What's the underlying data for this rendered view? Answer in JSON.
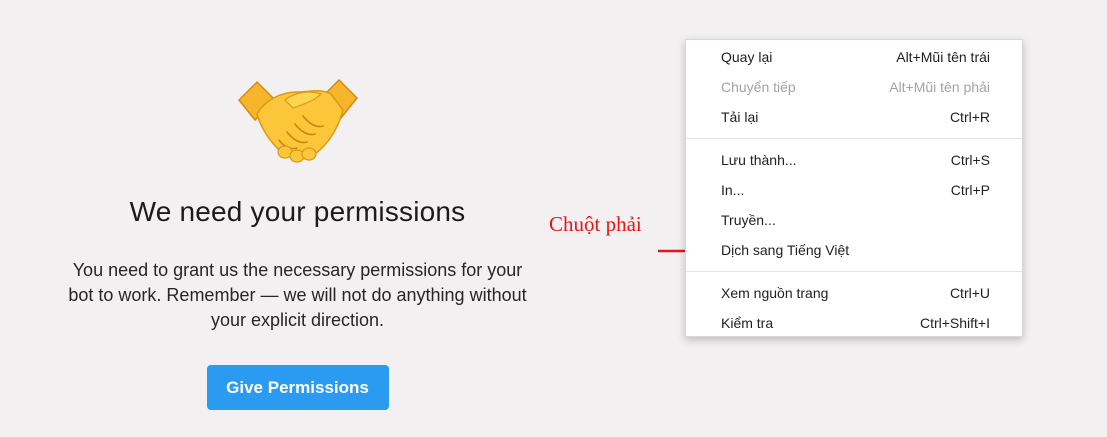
{
  "permissions": {
    "title": "We need your permissions",
    "description": "You need to grant us the necessary permissions for your bot to work. Remember — we will not do anything without your explicit direction.",
    "button_label": "Give Permissions",
    "icon": "handshake-emoji"
  },
  "annotation": {
    "label": "Chuột phải",
    "color": "#e8141b",
    "icon": "right-arrow"
  },
  "context_menu": {
    "groups": [
      [
        {
          "label": "Quay lại",
          "shortcut": "Alt+Mũi tên trái",
          "enabled": true
        },
        {
          "label": "Chuyển tiếp",
          "shortcut": "Alt+Mũi tên phải",
          "enabled": false
        },
        {
          "label": "Tải lại",
          "shortcut": "Ctrl+R",
          "enabled": true
        }
      ],
      [
        {
          "label": "Lưu thành...",
          "shortcut": "Ctrl+S",
          "enabled": true
        },
        {
          "label": "In...",
          "shortcut": "Ctrl+P",
          "enabled": true
        },
        {
          "label": "Truyền...",
          "shortcut": "",
          "enabled": true
        },
        {
          "label": "Dịch sang Tiếng Việt",
          "shortcut": "",
          "enabled": true
        }
      ],
      [
        {
          "label": "Xem nguồn trang",
          "shortcut": "Ctrl+U",
          "enabled": true
        },
        {
          "label": "Kiểm tra",
          "shortcut": "Ctrl+Shift+I",
          "enabled": true
        }
      ]
    ]
  },
  "colors": {
    "background": "#f2f0f1",
    "button": "#2a9bf0",
    "disabled_text": "#a3a3a3"
  }
}
